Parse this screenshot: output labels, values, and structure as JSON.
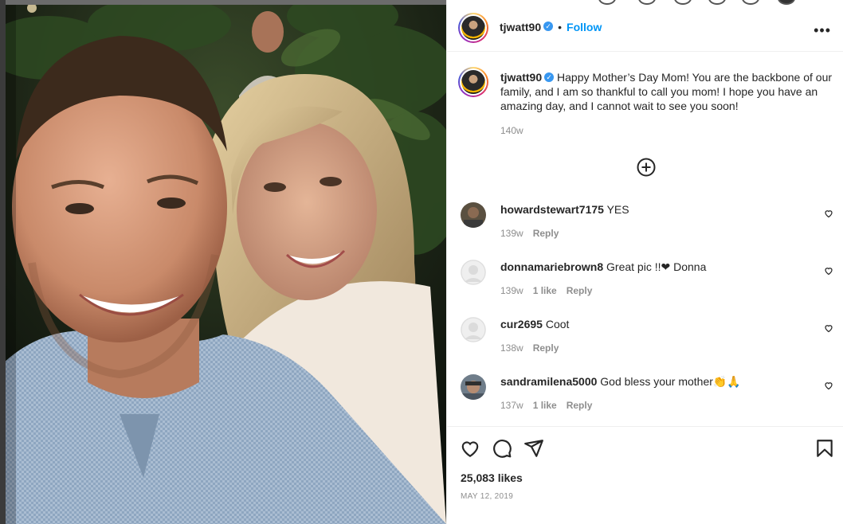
{
  "post": {
    "author": "tjwatt90",
    "follow_label": "Follow",
    "separator": "•",
    "more_label": "•••",
    "photo_alt": "Selfie of a young man and a smiling woman at night"
  },
  "caption": {
    "username": "tjwatt90",
    "text": "Happy Mother’s Day Mom! You are the backbone of our family, and I am so thankful to call you mom! I hope you have an amazing day, and I cannot wait to see you soon!",
    "time": "140w"
  },
  "comments": [
    {
      "username": "howardstewart7175",
      "text": "YES",
      "time": "139w",
      "likes": "",
      "reply": "Reply"
    },
    {
      "username": "donnamariebrown8",
      "text": "Great pic !!❤ Donna",
      "time": "139w",
      "likes": "1 like",
      "reply": "Reply"
    },
    {
      "username": "cur2695",
      "text": "Coot",
      "time": "138w",
      "likes": "",
      "reply": "Reply"
    },
    {
      "username": "sandramilena5000",
      "text": "God bless your mother👏🙏",
      "time": "137w",
      "likes": "1 like",
      "reply": "Reply"
    }
  ],
  "footer": {
    "likes": "25,083 likes",
    "date": "MAY 12, 2019"
  },
  "icons": {
    "more": "more-options-icon",
    "load_more": "plus-circle-icon",
    "like": "heart-icon",
    "comment": "comment-icon",
    "share": "paper-plane-icon",
    "save": "bookmark-icon"
  },
  "colors": {
    "link": "#0095f6",
    "verified": "#3897f0",
    "muted": "#8e8e8e",
    "text": "#262626"
  }
}
